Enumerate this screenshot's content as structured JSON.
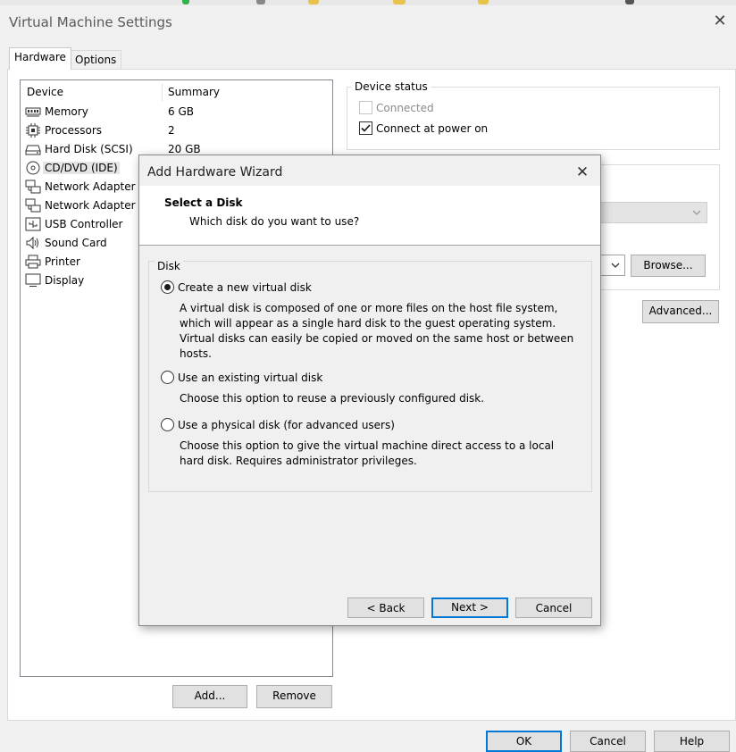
{
  "window": {
    "title": "Virtual Machine Settings",
    "close_glyph": "✕"
  },
  "tabs": [
    {
      "label": "Hardware",
      "active": true
    },
    {
      "label": "Options",
      "active": false
    }
  ],
  "device_list": {
    "columns": [
      "Device",
      "Summary"
    ],
    "rows": [
      {
        "name": "Memory",
        "summary": "6 GB",
        "icon": "memory-icon"
      },
      {
        "name": "Processors",
        "summary": "2",
        "icon": "processor-icon"
      },
      {
        "name": "Hard Disk (SCSI)",
        "summary": "20 GB",
        "icon": "hard-disk-icon"
      },
      {
        "name": "CD/DVD (IDE)",
        "summary": "",
        "icon": "cd-dvd-icon",
        "selected": true
      },
      {
        "name": "Network Adapter",
        "summary": "",
        "icon": "network-adapter-icon"
      },
      {
        "name": "Network Adapter 2",
        "summary": "",
        "icon": "network-adapter-icon"
      },
      {
        "name": "USB Controller",
        "summary": "",
        "icon": "usb-icon"
      },
      {
        "name": "Sound Card",
        "summary": "",
        "icon": "speaker-icon"
      },
      {
        "name": "Printer",
        "summary": "",
        "icon": "printer-icon"
      },
      {
        "name": "Display",
        "summary": "",
        "icon": "monitor-icon"
      }
    ],
    "add_button": "Add...",
    "remove_button": "Remove"
  },
  "device_status": {
    "label": "Device status",
    "connected_label": "Connected",
    "connected_checked": false,
    "connected_enabled": false,
    "power_on_label": "Connect at power on",
    "power_on_checked": true
  },
  "connection": {
    "browse_button": "Browse...",
    "advanced_button": "Advanced..."
  },
  "footer": {
    "ok": "OK",
    "cancel": "Cancel",
    "help": "Help"
  },
  "wizard": {
    "title": "Add Hardware Wizard",
    "heading": "Select a Disk",
    "subheading": "Which disk do you want to use?",
    "group_label": "Disk",
    "options": [
      {
        "label": "Create a new virtual disk",
        "selected": true,
        "description": "A virtual disk is composed of one or more files on the host file system, which will appear as a single hard disk to the guest operating system. Virtual disks can easily be copied or moved on the same host or between hosts."
      },
      {
        "label": "Use an existing virtual disk",
        "selected": false,
        "description": "Choose this option to reuse a previously configured disk."
      },
      {
        "label": "Use a physical disk (for advanced users)",
        "selected": false,
        "description": "Choose this option to give the virtual machine direct access to a local hard disk. Requires administrator privileges."
      }
    ],
    "back_button": "< Back",
    "next_button": "Next >",
    "cancel_button": "Cancel"
  },
  "colors": {
    "accent": "#0078d7",
    "window_bg": "#f0f0f0",
    "panel_bg": "#ffffff",
    "disabled_text": "#8a8a8a"
  }
}
